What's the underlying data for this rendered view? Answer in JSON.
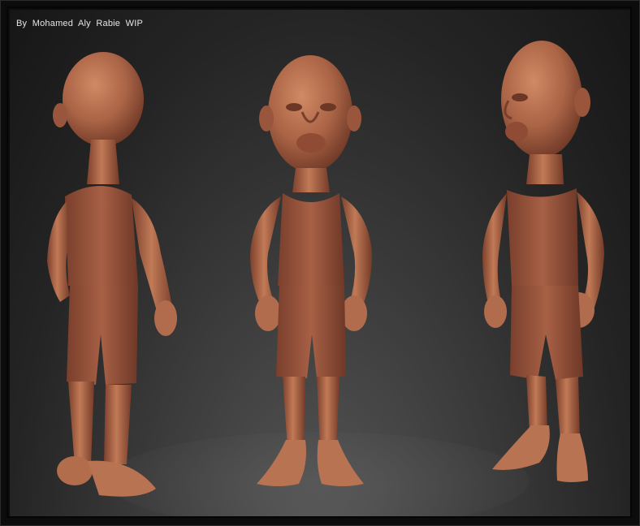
{
  "caption": "By  Mohamed  Aly  Rabie  WIP",
  "colors": {
    "background_top": "#161616",
    "background_bottom": "#5a5a5a",
    "clay_light": "#c7805c",
    "clay_mid": "#a35e41",
    "clay_dark": "#6a3524",
    "frame": "#050505"
  },
  "views": [
    {
      "name": "back-three-quarter-view"
    },
    {
      "name": "front-view"
    },
    {
      "name": "side-three-quarter-view"
    }
  ]
}
